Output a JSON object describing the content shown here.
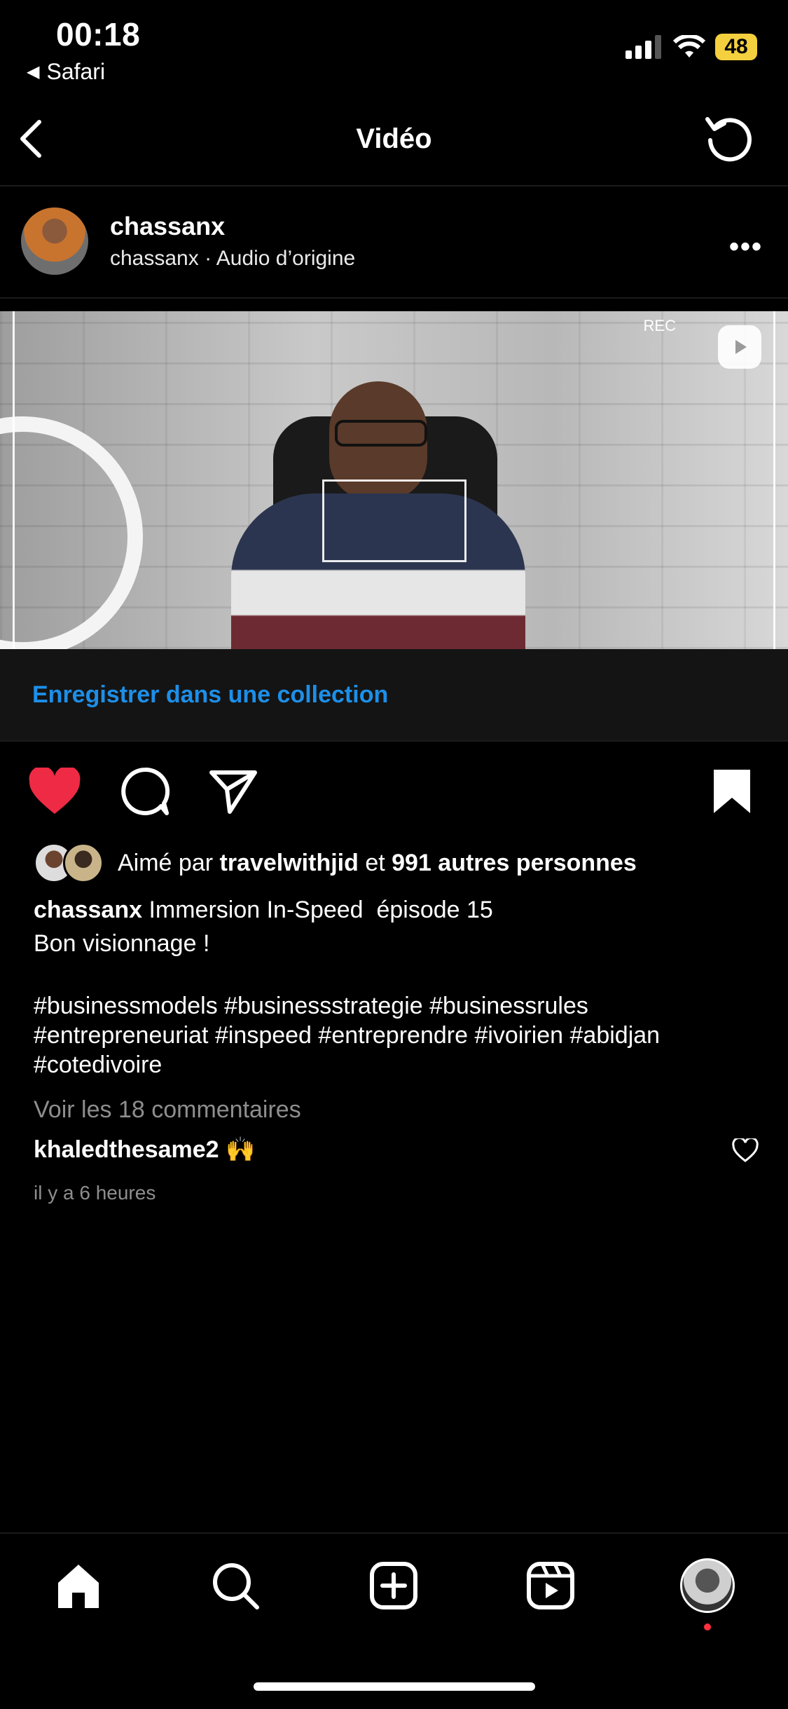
{
  "status_bar": {
    "time": "00:18",
    "back_app": "Safari",
    "battery": "48"
  },
  "nav": {
    "title": "Vidéo"
  },
  "post": {
    "username": "chassanx",
    "audio_line": "chassanx · Audio d’origine",
    "video_overlay": {
      "rec_label": "REC"
    },
    "save_collection_label": "Enregistrer dans une collection",
    "likes": {
      "prefix": "Aimé par ",
      "user": "travelwithjid",
      "middle": " et ",
      "count_text": "991 autres personnes"
    },
    "caption": {
      "author": "chassanx",
      "text_line1": " Immersion In-Speed  épisode 15",
      "text_line2": "Bon visionnage !",
      "hashtags": "#businessmodels #businessstrategie #businessrules #entrepreneuriat #inspeed  #entreprendre #ivoirien #abidjan #cotedivoire"
    },
    "view_comments": "Voir les 18 commentaires",
    "top_comment": {
      "user": "khaledthesame2",
      "text": " 🙌"
    },
    "time_ago": "il y a 6 heures",
    "liked": true,
    "saved": true
  },
  "tabbar": {
    "items": [
      "home-icon",
      "search-icon",
      "create-icon",
      "reels-icon",
      "profile-avatar"
    ]
  },
  "colors": {
    "link_blue": "#1d8fe8",
    "like_red": "#ee2a45",
    "notification_red": "#ff3040"
  }
}
